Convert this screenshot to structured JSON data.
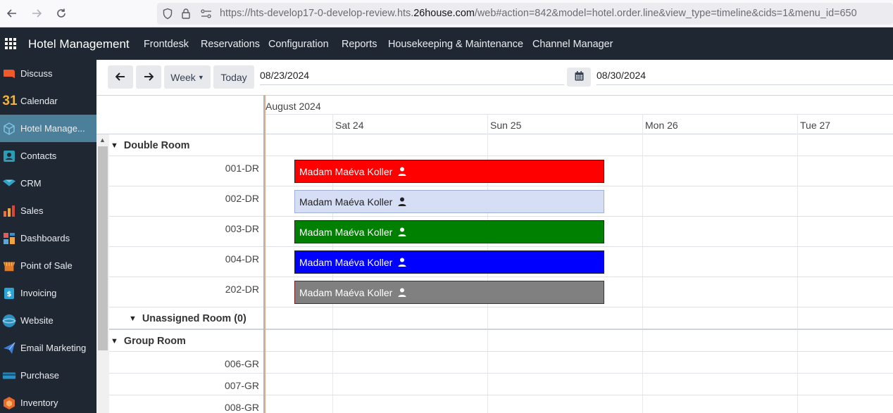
{
  "browser": {
    "url_prefix": "https://hts-develop17-0-develop-review.hts.",
    "url_domain": "26house.com",
    "url_suffix": "/web#action=842&model=hotel.order.line&view_type=timeline&cids=1&menu_id=650"
  },
  "app": {
    "title": "Hotel Management",
    "menu": [
      "Frontdesk",
      "Reservations",
      "Configuration",
      "Reports",
      "Housekeeping & Maintenance",
      "Channel Manager"
    ]
  },
  "sidebar": {
    "items": [
      {
        "label": "Discuss",
        "icon": "discuss-icon"
      },
      {
        "label": "Calendar",
        "icon": "calendar-icon"
      },
      {
        "label": "Hotel Manage...",
        "icon": "hotel-cube-icon",
        "active": true
      },
      {
        "label": "Contacts",
        "icon": "contacts-icon"
      },
      {
        "label": "CRM",
        "icon": "crm-icon"
      },
      {
        "label": "Sales",
        "icon": "sales-icon"
      },
      {
        "label": "Dashboards",
        "icon": "dashboards-icon"
      },
      {
        "label": "Point of Sale",
        "icon": "pos-icon"
      },
      {
        "label": "Invoicing",
        "icon": "invoicing-icon"
      },
      {
        "label": "Website",
        "icon": "website-icon"
      },
      {
        "label": "Email Marketing",
        "icon": "email-marketing-icon"
      },
      {
        "label": "Purchase",
        "icon": "purchase-icon"
      },
      {
        "label": "Inventory",
        "icon": "inventory-icon"
      }
    ]
  },
  "controls": {
    "prev_icon": "arrow-left-icon",
    "next_icon": "arrow-right-icon",
    "scale_label": "Week",
    "today_label": "Today",
    "start_date": "08/23/2024",
    "end_date": "08/30/2024"
  },
  "timeline": {
    "month": "August 2024",
    "days": [
      "Sat 24",
      "Sun 25",
      "Mon 26",
      "Tue 27"
    ],
    "groups": [
      {
        "name": "Double Room",
        "rooms": [
          "001-DR",
          "002-DR",
          "003-DR",
          "004-DR",
          "202-DR"
        ]
      },
      {
        "name": "Unassigned Room (0)"
      },
      {
        "name": "Group Room",
        "rooms": [
          "006-GR",
          "007-GR",
          "008-GR"
        ]
      }
    ],
    "bookings": [
      {
        "guest": "Madam Maéva Koller",
        "room": "001-DR",
        "bg": "#ff0000",
        "fg": "#ffffff"
      },
      {
        "guest": "Madam Maéva Koller",
        "room": "002-DR",
        "bg": "#d6def5",
        "fg": "#222222"
      },
      {
        "guest": "Madam Maéva Koller",
        "room": "003-DR",
        "bg": "#008000",
        "fg": "#ffffff"
      },
      {
        "guest": "Madam Maéva Koller",
        "room": "004-DR",
        "bg": "#0000ff",
        "fg": "#ffffff"
      },
      {
        "guest": "Madam Maéva Koller",
        "room": "202-DR",
        "bg": "#808080",
        "fg": "#ffffff"
      }
    ]
  }
}
